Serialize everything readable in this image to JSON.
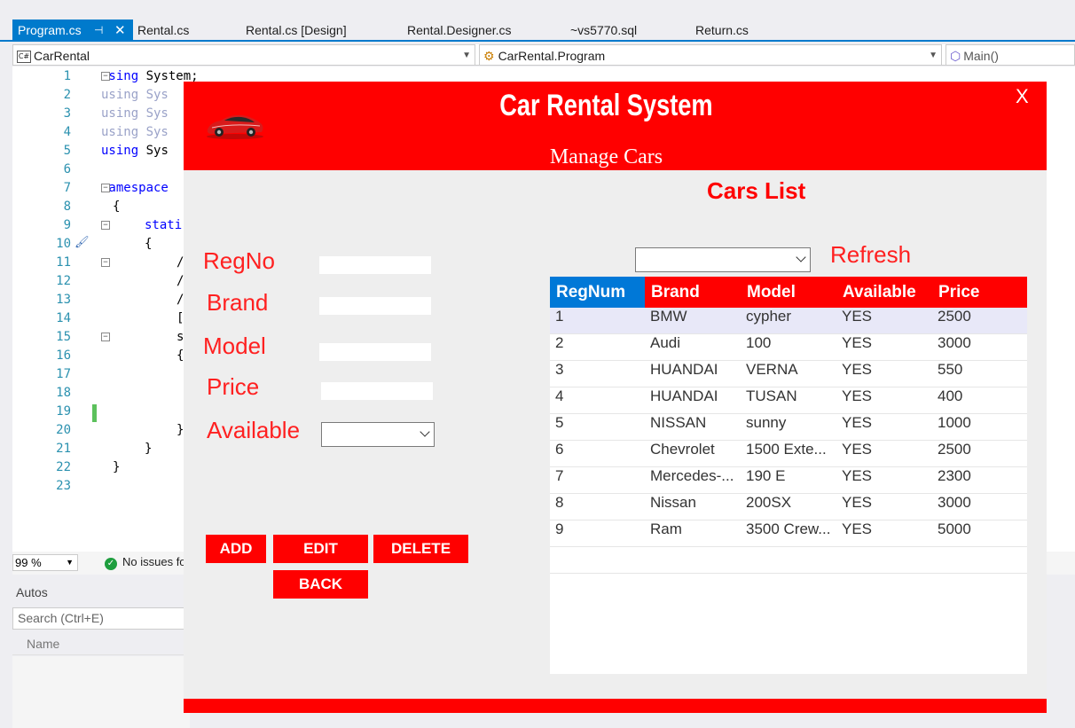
{
  "vs": {
    "tabs": [
      {
        "label": "Program.cs",
        "active": true
      },
      {
        "label": "Rental.cs"
      },
      {
        "label": "Rental.cs [Design]"
      },
      {
        "label": "Rental.Designer.cs"
      },
      {
        "label": "~vs5770.sql"
      },
      {
        "label": "Return.cs"
      }
    ],
    "pin_glyph": "⊣",
    "close_glyph": "✕",
    "nav_project": "CarRental",
    "nav_class": "CarRental.Program",
    "nav_member": "Main()",
    "line_numbers": [
      "1",
      "2",
      "3",
      "4",
      "5",
      "6",
      "7",
      "8",
      "9",
      "10",
      "11",
      "12",
      "13",
      "14",
      "15",
      "16",
      "17",
      "18",
      "19",
      "20",
      "21",
      "22",
      "23"
    ],
    "code": {
      "l1_kw": "using",
      "l1_rest": " System;",
      "l2": "using Sys",
      "l3": "using Sys",
      "l4": "using Sys",
      "l5_kw": "using",
      "l5_rest": " Sys",
      "l7_kw": "namespace",
      "l8": "{",
      "l9_kw": "stati",
      "l10": "{",
      "l11": "/",
      "l12": "/",
      "l13": "/",
      "l14": "[",
      "l15": "s",
      "l16": "{",
      "l20": "}",
      "l21": "}",
      "l22": "}"
    },
    "zoom": "99 %",
    "issues": "No issues fo",
    "autos_title": "Autos",
    "autos_search": "Search (Ctrl+E)",
    "autos_col_name": "Name"
  },
  "app": {
    "title": "Car Rental System",
    "subtitle": "Manage Cars",
    "close": "X",
    "accent": "#ff0000",
    "form": {
      "regno_label": "RegNo",
      "brand_label": "Brand",
      "model_label": "Model",
      "price_label": "Price",
      "available_label": "Available",
      "regno_value": "",
      "brand_value": "",
      "model_value": "",
      "price_value": "",
      "available_value": ""
    },
    "buttons": {
      "add": "ADD",
      "edit": "EDIT",
      "delete": "DELETE",
      "back": "BACK"
    },
    "list_title": "Cars  List",
    "filter_value": "",
    "refresh": "Refresh",
    "grid": {
      "headers": [
        "RegNum",
        "Brand",
        "Model",
        "Available",
        "Price"
      ],
      "rows": [
        [
          "1",
          "BMW",
          "cypher",
          "YES",
          "2500"
        ],
        [
          "2",
          "Audi",
          "100",
          "YES",
          "3000"
        ],
        [
          "3",
          "HUANDAI",
          "VERNA",
          "YES",
          "550"
        ],
        [
          "4",
          "HUANDAI",
          "TUSAN",
          "YES",
          "400"
        ],
        [
          "5",
          "NISSAN",
          "sunny",
          "YES",
          "1000"
        ],
        [
          "6",
          "Chevrolet",
          "1500 Exte...",
          "YES",
          "2500"
        ],
        [
          "7",
          "Mercedes-...",
          "190 E",
          "YES",
          "2300"
        ],
        [
          "8",
          "Nissan",
          "200SX",
          "YES",
          "3000"
        ],
        [
          "9",
          "Ram",
          "3500 Crew...",
          "YES",
          "5000"
        ]
      ]
    }
  }
}
